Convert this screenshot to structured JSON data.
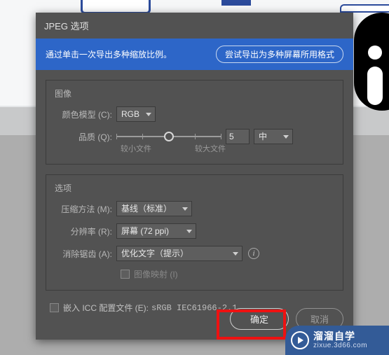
{
  "dialog": {
    "title": "JPEG 选项",
    "banner_text": "通过单击一次导出多种缩放比例。",
    "banner_button": "尝试导出为多种屏幕所用格式"
  },
  "image_panel": {
    "heading": "图像",
    "color_model_label": "颜色模型 (C):",
    "color_model_value": "RGB",
    "quality_label": "品质 (Q):",
    "quality_value": "5",
    "quality_preset": "中",
    "slider_min_caption": "较小文件",
    "slider_max_caption": "较大文件"
  },
  "options_panel": {
    "heading": "选项",
    "compression_label": "压缩方法 (M):",
    "compression_value": "基线（标准）",
    "resolution_label": "分辨率 (R):",
    "resolution_value": "屏幕 (72 ppi)",
    "antialias_label": "消除锯齿 (A):",
    "antialias_value": "优化文字（提示）",
    "imagemap_label": "图像映射 (I)"
  },
  "embed": {
    "label": "嵌入 ICC 配置文件 (E):",
    "value": "sRGB IEC61966-2.1"
  },
  "buttons": {
    "ok": "确定",
    "cancel": "取消"
  },
  "watermark": {
    "cn": "溜溜自学",
    "url": "zixue.3d66.com"
  }
}
